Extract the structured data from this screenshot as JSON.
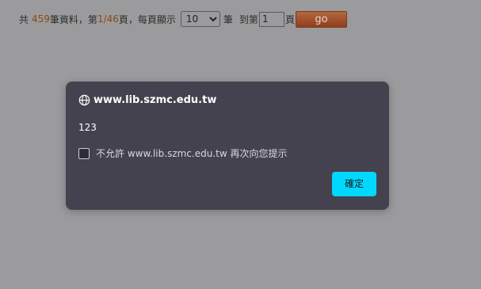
{
  "pager": {
    "prefix": "共",
    "total": "459",
    "records_label": "筆資料，第",
    "current": "1/46",
    "page_label": "頁，每頁顯示",
    "per_page": "10",
    "per_page_unit": "筆",
    "goto_label": "到第",
    "goto_value": "1",
    "goto_unit": "頁",
    "go_label": "go"
  },
  "dialog": {
    "title": "www.lib.szmc.edu.tw",
    "message": "123",
    "suppress_label": "不允許 www.lib.szmc.edu.tw 再次向您提示",
    "ok_label": "確定"
  },
  "colors": {
    "overlay": "#9b9a9c",
    "dialog_bg": "#44424f",
    "ok_button": "#00d8ff",
    "go_button": "#a2522d",
    "number_text": "#8a4a12"
  },
  "icons": {
    "title_icon": "globe-icon"
  }
}
